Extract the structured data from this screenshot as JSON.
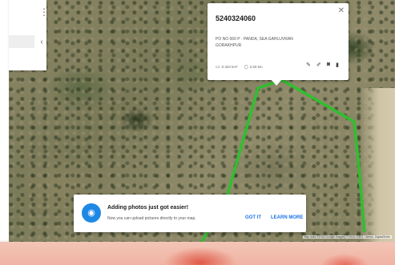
{
  "sidebar": {
    "menu_icon": "more-vert-icon",
    "collapse_icon": "chevron-left-icon"
  },
  "popup": {
    "title": "5240324060",
    "address_line1": "PO NO 060 P · PANDA, SEA GAHLUVRAN",
    "address_line2": "GORAKHPUR",
    "meta_area": "0.334 km²",
    "meta_perimeter": "2.50 km",
    "close_icon": "close-icon",
    "tool_icons": [
      "style-icon",
      "edit-icon",
      "camera-icon",
      "delete-icon"
    ]
  },
  "toast": {
    "title": "Adding photos just got easier!",
    "body": "Now you can upload pictures directly to your map.",
    "got_it": "GOT IT",
    "learn_more": "LEARN MORE",
    "icon": "camera-icon"
  },
  "map": {
    "attribution": "Map data ©2018 Google Imagery ©2018 CNES / Airbus, DigitalGlobe",
    "boundary_color": "#2fbf2f"
  }
}
